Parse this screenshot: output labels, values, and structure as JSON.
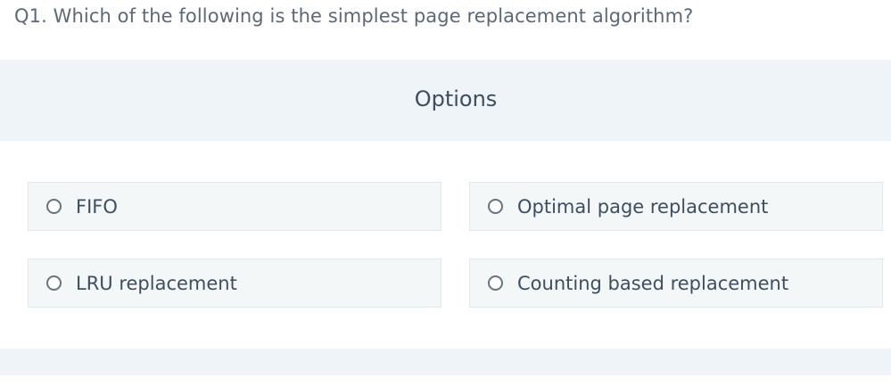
{
  "question": {
    "text": "Q1. Which of the following is the simplest page replacement algorithm?"
  },
  "options_header": {
    "title": "Options"
  },
  "options": [
    {
      "label": "FIFO",
      "selected": false
    },
    {
      "label": "Optimal page replacement",
      "selected": false
    },
    {
      "label": "LRU replacement",
      "selected": false
    },
    {
      "label": "Counting based replacement",
      "selected": false
    }
  ],
  "colors": {
    "header_band": "#eef4f7",
    "option_bg": "#f3f7f8",
    "text": "#3e4e60",
    "question_text": "#5b6878"
  }
}
